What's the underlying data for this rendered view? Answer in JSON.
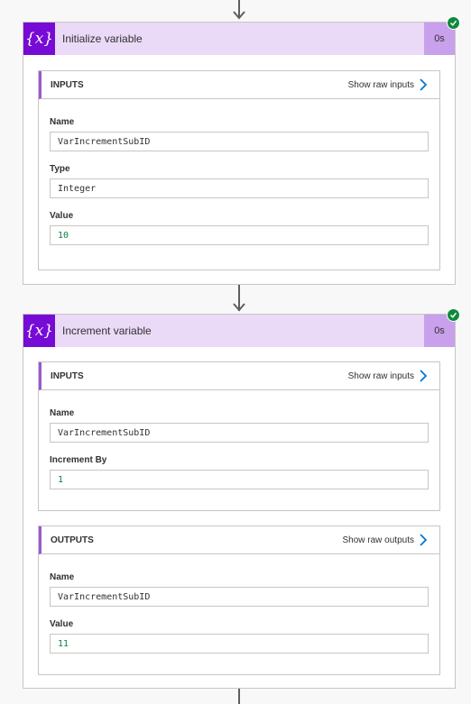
{
  "cards": [
    {
      "title": "Initialize variable",
      "duration": "0s",
      "icon": "{x}",
      "inputs": {
        "heading": "INPUTS",
        "raw_link": "Show raw inputs",
        "fields": [
          {
            "label": "Name",
            "value": "VarIncrementSubID"
          },
          {
            "label": "Type",
            "value": "Integer"
          },
          {
            "label": "Value",
            "value": "10"
          }
        ]
      }
    },
    {
      "title": "Increment variable",
      "duration": "0s",
      "icon": "{x}",
      "inputs": {
        "heading": "INPUTS",
        "raw_link": "Show raw inputs",
        "fields": [
          {
            "label": "Name",
            "value": "VarIncrementSubID"
          },
          {
            "label": "Increment By",
            "value": "1"
          }
        ]
      },
      "outputs": {
        "heading": "OUTPUTS",
        "raw_link": "Show raw outputs",
        "fields": [
          {
            "label": "Name",
            "value": "VarIncrementSubID"
          },
          {
            "label": "Value",
            "value": "11"
          }
        ]
      }
    }
  ],
  "colors": {
    "header_bg": "#ead9f7",
    "icon_bg": "#770bd6",
    "duration_bg": "#c9a0ec",
    "accent": "#9b57d3",
    "success": "#0f8a3c",
    "number_text": "#107c41"
  },
  "icons": [
    "arrow-down-icon",
    "variable-icon",
    "success-check-icon",
    "chevron-right-icon"
  ]
}
